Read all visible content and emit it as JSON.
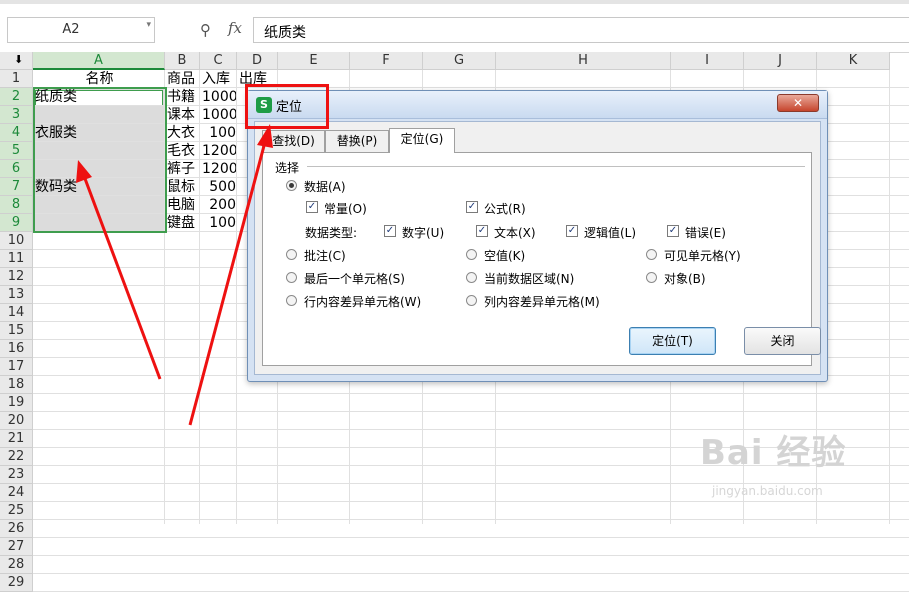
{
  "formula_bar": {
    "name_box": "A2",
    "fx": "fx",
    "formula": "纸质类"
  },
  "grid": {
    "columns": [
      "A",
      "B",
      "C",
      "D",
      "E",
      "F",
      "G",
      "H",
      "I",
      "J",
      "K"
    ],
    "rows": [
      "1",
      "2",
      "3",
      "4",
      "5",
      "6",
      "7",
      "8",
      "9",
      "10",
      "11",
      "12",
      "13",
      "14",
      "15",
      "16",
      "17",
      "18",
      "19",
      "20",
      "21",
      "22",
      "23",
      "24",
      "25",
      "26",
      "27",
      "28",
      "29"
    ],
    "cells": {
      "A1": "名称",
      "A2": "纸质类",
      "A4": "衣服类",
      "A7": "数码类",
      "B1": "商品",
      "B2": "书籍",
      "B3": "课本",
      "B4": "大衣",
      "B5": "毛衣",
      "B6": "裤子",
      "B7": "鼠标",
      "B8": "电脑",
      "B9": "键盘",
      "C1": "入库",
      "C2": "1000",
      "C3": "1000",
      "C4": "100",
      "C5": "1200",
      "C6": "1200",
      "C7": "500",
      "C8": "200",
      "C9": "100",
      "D1": "出库"
    }
  },
  "dialog": {
    "title": "定位",
    "logo": "S",
    "close": "✕",
    "tabs": [
      {
        "label": "查找(D)",
        "active": false
      },
      {
        "label": "替换(P)",
        "active": false
      },
      {
        "label": "定位(G)",
        "active": true
      }
    ],
    "group": "选择",
    "options": {
      "data": "数据(A)",
      "constant": "常量(O)",
      "formula": "公式(R)",
      "data_type": "数据类型:",
      "number": "数字(U)",
      "text": "文本(X)",
      "logical": "逻辑值(L)",
      "error": "错误(E)",
      "comment": "批注(C)",
      "blank": "空值(K)",
      "visible": "可见单元格(Y)",
      "last_cell": "最后一个单元格(S)",
      "current_region": "当前数据区域(N)",
      "object": "对象(B)",
      "row_diff": "行内容差异单元格(W)",
      "col_diff": "列内容差异单元格(M)"
    },
    "buttons": {
      "goto": "定位(T)",
      "close": "关闭"
    }
  },
  "watermark": {
    "brand": "Bai 经验",
    "url": "jingyan.baidu.com"
  },
  "colors": {
    "selection_green": "#3f9d4e",
    "annotation_red": "#ee1111"
  }
}
